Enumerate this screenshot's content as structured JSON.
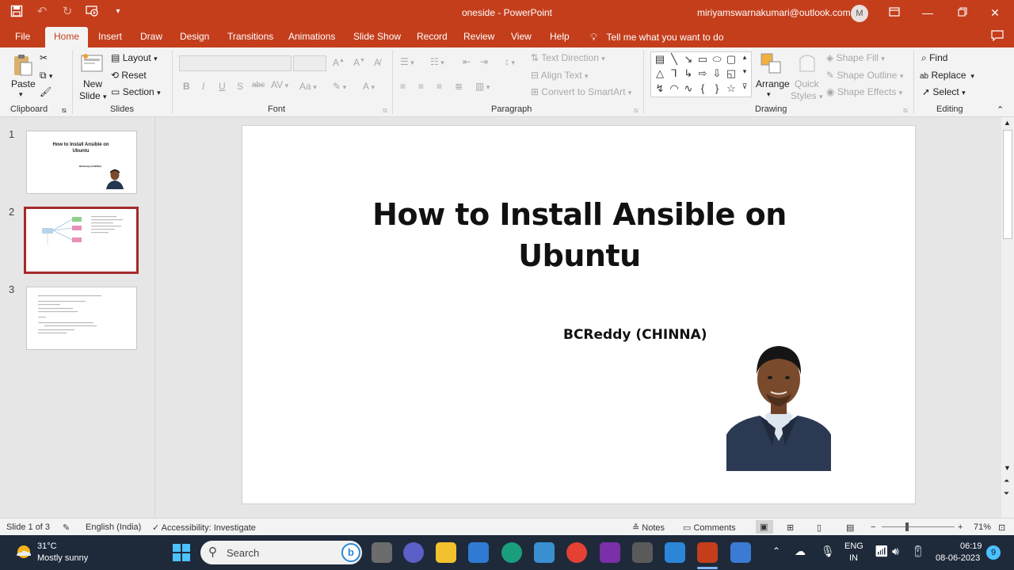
{
  "app": {
    "doc_title": "oneside  -  PowerPoint",
    "account_email": "miriyamswarnakumari@outlook.com",
    "avatar_letter": "M"
  },
  "tabs": [
    "File",
    "Home",
    "Insert",
    "Draw",
    "Design",
    "Transitions",
    "Animations",
    "Slide Show",
    "Record",
    "Review",
    "View",
    "Help"
  ],
  "tell_me": "Tell me what you want to do",
  "ribbon": {
    "clipboard": {
      "paste": "Paste",
      "label": "Clipboard"
    },
    "slides": {
      "new_slide_1": "New",
      "new_slide_2": "Slide",
      "layout": "Layout",
      "reset": "Reset",
      "section": "Section",
      "label": "Slides"
    },
    "font": {
      "label": "Font"
    },
    "paragraph": {
      "label": "Paragraph",
      "text_direction": "Text Direction",
      "align_text": "Align Text",
      "convert_smartart": "Convert to SmartArt"
    },
    "drawing": {
      "label": "Drawing",
      "arrange": "Arrange",
      "quick_styles_1": "Quick",
      "quick_styles_2": "Styles",
      "shape_fill": "Shape Fill",
      "shape_outline": "Shape Outline",
      "shape_effects": "Shape Effects"
    },
    "editing": {
      "label": "Editing",
      "find": "Find",
      "replace": "Replace",
      "select": "Select"
    }
  },
  "thumbnails": [
    {
      "num": "1",
      "title": "How to Install Ansible on Ubuntu",
      "author": "BCReddy (CHINNA)"
    },
    {
      "num": "2"
    },
    {
      "num": "3"
    }
  ],
  "slide": {
    "title_line1": "How to Install Ansible on",
    "title_line2": "Ubuntu",
    "author": "BCReddy (CHINNA)"
  },
  "status": {
    "slide_info": "Slide 1 of 3",
    "language": "English (India)",
    "accessibility": "Accessibility: Investigate",
    "notes": "Notes",
    "comments": "Comments",
    "zoom": "71%"
  },
  "taskbar": {
    "temperature": "31°C",
    "weather": "Mostly sunny",
    "search_placeholder": "Search",
    "lang_1": "ENG",
    "lang_2": "IN",
    "time": "06:19",
    "date": "08-06-2023",
    "notification_count": "9"
  },
  "colors": {
    "accent": "#c43e1c",
    "selected_thumb_border": "#a52a2a",
    "taskbar": "#1e2a3a"
  }
}
